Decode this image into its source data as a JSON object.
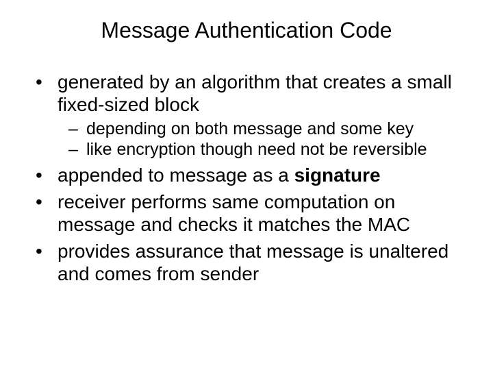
{
  "title": "Message Authentication Code",
  "bullets": {
    "b1": "generated by an algorithm that creates a small fixed-sized block",
    "b1_sub1": "depending on both message and some key",
    "b1_sub2": "like encryption though need not be reversible",
    "b2_pre": "appended to message as a ",
    "b2_bold": "signature",
    "b3": "receiver performs same computation on message and checks it matches the MAC",
    "b4": "provides assurance that message is unaltered and comes from sender"
  }
}
